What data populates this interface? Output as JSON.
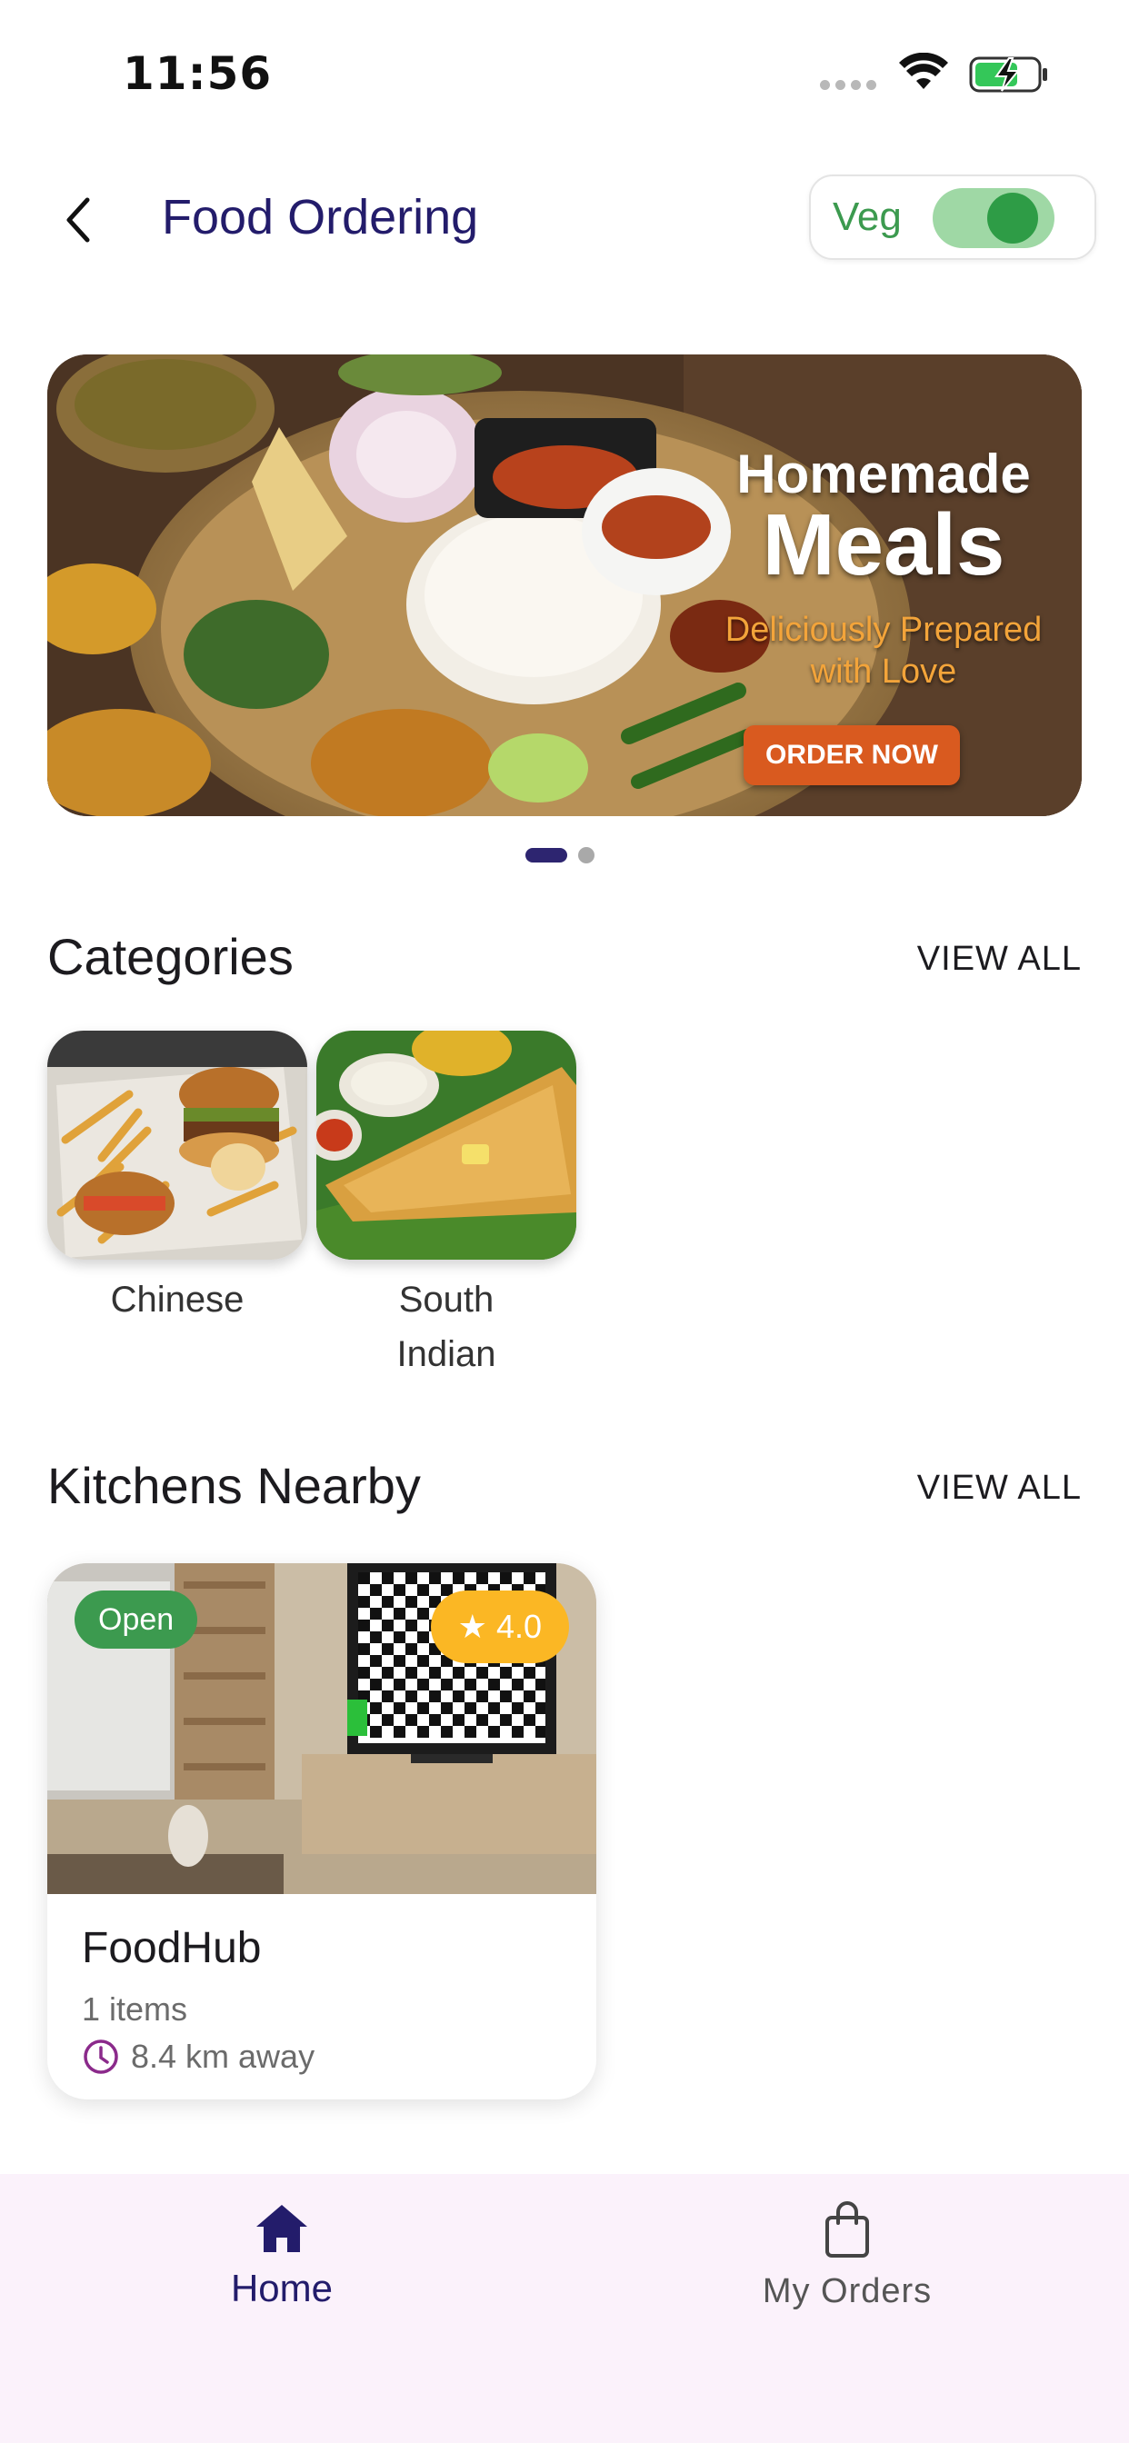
{
  "status_bar": {
    "time": "11:56"
  },
  "header": {
    "title": "Food Ordering",
    "veg_toggle": {
      "label": "Veg",
      "on": true
    }
  },
  "banner": {
    "line1": "Homemade",
    "line2": "Meals",
    "subtitle_line1": "Deliciously Prepared",
    "subtitle_line2": "with Love",
    "cta": "ORDER NOW",
    "page_count": 2,
    "active_page": 1
  },
  "categories": {
    "title": "Categories",
    "view_all": "VIEW ALL",
    "items": [
      {
        "label": "Chinese"
      },
      {
        "label": "South Indian",
        "label_line1": "South",
        "label_line2": "Indian"
      }
    ]
  },
  "kitchens": {
    "title": "Kitchens Nearby",
    "view_all": "VIEW ALL",
    "items": [
      {
        "status": "Open",
        "rating": "4.0",
        "name": "FoodHub",
        "items_text": "1 items",
        "distance": "8.4 km away"
      }
    ]
  },
  "bottom_nav": {
    "items": [
      {
        "label": "Home",
        "icon": "home-icon",
        "active": true
      },
      {
        "label": "My Orders",
        "icon": "shopping-bag-icon",
        "active": false
      }
    ]
  },
  "colors": {
    "primary": "#231c6b",
    "veg_green": "#3c9a4f",
    "rating_yellow": "#fbb724",
    "cta_orange": "#d95a1f",
    "nav_bg": "#fbf2fb"
  }
}
